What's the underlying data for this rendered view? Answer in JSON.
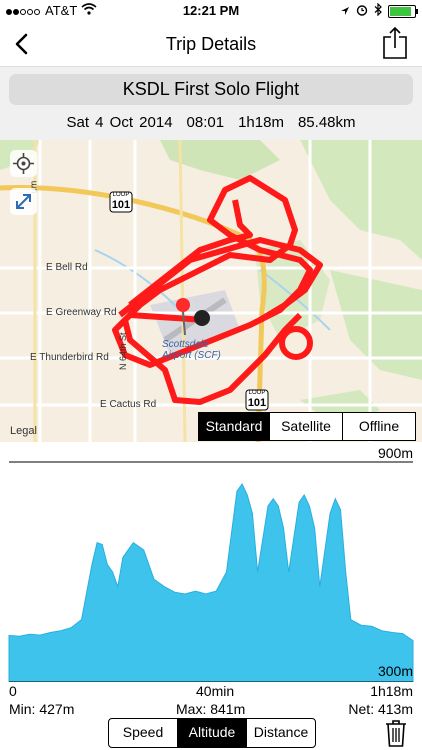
{
  "status": {
    "carrier": "AT&T",
    "time": "12:21 PM"
  },
  "nav": {
    "title": "Trip Details",
    "back_icon": "chevron-left-icon",
    "share_icon": "share-icon"
  },
  "trip": {
    "name": "KSDL First Solo Flight",
    "date": "Sat 4 Oct 2014",
    "start": "08:01",
    "duration": "1h18m",
    "distance": "85.48km"
  },
  "map": {
    "legal": "Legal",
    "labels": {
      "road_101_a": "101",
      "road_101_b": "101",
      "loop": "LOOP",
      "bell": "E Bell Rd",
      "greenway": "E Greenway Rd",
      "thunderbird": "E Thunderbird Rd",
      "cactus": "E Cactus Rd",
      "street64": "N 64th St",
      "airport": "Scottsdale Airport (SCF)",
      "um": "um"
    },
    "modes": [
      "Standard",
      "Satellite",
      "Offline"
    ],
    "selected_mode": "Standard"
  },
  "chart_data": {
    "type": "area",
    "ylabel_top": "900m",
    "ylabel_bottom": "300m",
    "ylim": [
      300,
      900
    ],
    "x_tick_labels": [
      "0",
      "40min",
      "1h18m"
    ],
    "x": [
      0,
      2,
      4,
      6,
      8,
      10,
      12,
      14,
      16,
      17,
      18,
      19,
      20,
      21,
      22,
      24,
      26,
      28,
      30,
      32,
      34,
      36,
      38,
      40,
      42,
      44,
      45,
      46,
      47,
      48,
      50,
      51,
      52,
      53,
      54,
      56,
      57,
      58,
      59,
      60,
      62,
      63,
      64,
      65,
      66,
      68,
      70,
      72,
      74,
      76,
      78
    ],
    "y": [
      427,
      425,
      430,
      428,
      435,
      440,
      448,
      470,
      620,
      680,
      675,
      620,
      600,
      560,
      640,
      680,
      660,
      580,
      560,
      545,
      540,
      548,
      540,
      548,
      600,
      820,
      840,
      810,
      760,
      600,
      780,
      800,
      780,
      720,
      600,
      790,
      810,
      780,
      720,
      560,
      760,
      800,
      770,
      600,
      470,
      455,
      452,
      440,
      435,
      432,
      413
    ]
  },
  "stats": {
    "min": "Min: 427m",
    "max": "Max: 841m",
    "net": "Net: 413m"
  },
  "graph_modes": [
    "Speed",
    "Altitude",
    "Distance"
  ],
  "selected_graph": "Altitude",
  "colors": {
    "route": "#ff1a1a",
    "chart_fill": "#3ec4ec",
    "chart_stroke": "#29aee0"
  }
}
